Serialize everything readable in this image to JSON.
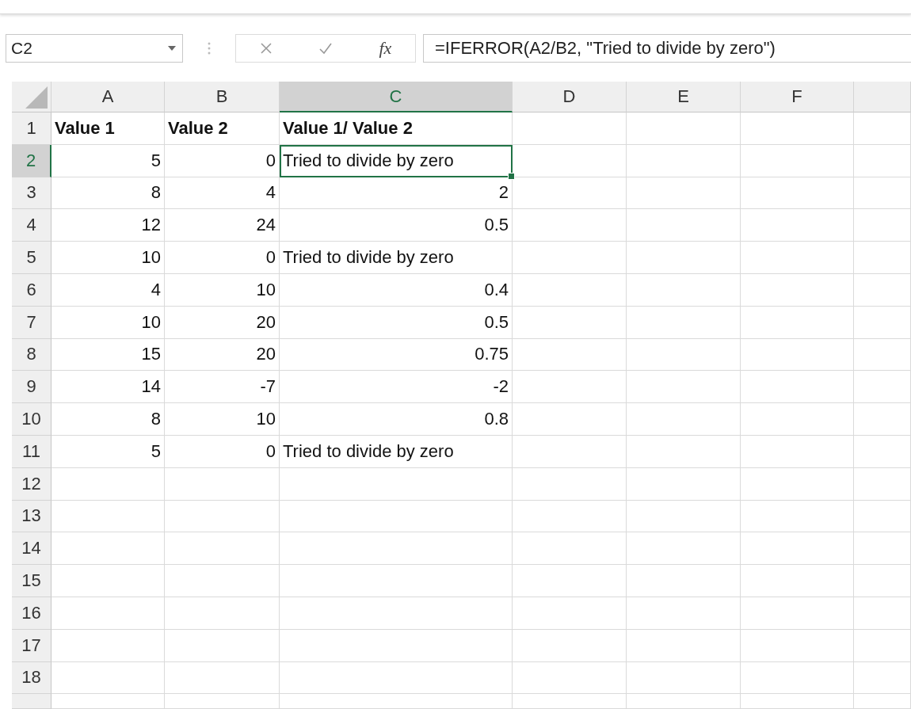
{
  "formula_bar": {
    "name_box": "C2",
    "fx": "fx",
    "formula": "=IFERROR(A2/B2, \"Tried to divide by zero\")"
  },
  "columns": [
    {
      "label": "A",
      "selected": false
    },
    {
      "label": "B",
      "selected": false
    },
    {
      "label": "C",
      "selected": true
    },
    {
      "label": "D",
      "selected": false
    },
    {
      "label": "E",
      "selected": false
    },
    {
      "label": "F",
      "selected": false
    }
  ],
  "rows": [
    {
      "label": "1",
      "selected": false,
      "cells": [
        {
          "text": "Value 1",
          "kind": "header",
          "selected": false
        },
        {
          "text": "Value 2",
          "kind": "header",
          "selected": false
        },
        {
          "text": "Value 1/ Value 2",
          "kind": "header",
          "selected": false
        }
      ]
    },
    {
      "label": "2",
      "selected": true,
      "cells": [
        {
          "text": "5",
          "kind": "number",
          "selected": false
        },
        {
          "text": "0",
          "kind": "number",
          "selected": false
        },
        {
          "text": "Tried to divide by zero",
          "kind": "text",
          "selected": true
        }
      ]
    },
    {
      "label": "3",
      "selected": false,
      "cells": [
        {
          "text": "8",
          "kind": "number",
          "selected": false
        },
        {
          "text": "4",
          "kind": "number",
          "selected": false
        },
        {
          "text": "2",
          "kind": "number",
          "selected": false
        }
      ]
    },
    {
      "label": "4",
      "selected": false,
      "cells": [
        {
          "text": "12",
          "kind": "number",
          "selected": false
        },
        {
          "text": "24",
          "kind": "number",
          "selected": false
        },
        {
          "text": "0.5",
          "kind": "number",
          "selected": false
        }
      ]
    },
    {
      "label": "5",
      "selected": false,
      "cells": [
        {
          "text": "10",
          "kind": "number",
          "selected": false
        },
        {
          "text": "0",
          "kind": "number",
          "selected": false
        },
        {
          "text": "Tried to divide by zero",
          "kind": "text",
          "selected": false
        }
      ]
    },
    {
      "label": "6",
      "selected": false,
      "cells": [
        {
          "text": "4",
          "kind": "number",
          "selected": false
        },
        {
          "text": "10",
          "kind": "number",
          "selected": false
        },
        {
          "text": "0.4",
          "kind": "number",
          "selected": false
        }
      ]
    },
    {
      "label": "7",
      "selected": false,
      "cells": [
        {
          "text": "10",
          "kind": "number",
          "selected": false
        },
        {
          "text": "20",
          "kind": "number",
          "selected": false
        },
        {
          "text": "0.5",
          "kind": "number",
          "selected": false
        }
      ]
    },
    {
      "label": "8",
      "selected": false,
      "cells": [
        {
          "text": "15",
          "kind": "number",
          "selected": false
        },
        {
          "text": "20",
          "kind": "number",
          "selected": false
        },
        {
          "text": "0.75",
          "kind": "number",
          "selected": false
        }
      ]
    },
    {
      "label": "9",
      "selected": false,
      "cells": [
        {
          "text": "14",
          "kind": "number",
          "selected": false
        },
        {
          "text": "-7",
          "kind": "number",
          "selected": false
        },
        {
          "text": "-2",
          "kind": "number",
          "selected": false
        }
      ]
    },
    {
      "label": "10",
      "selected": false,
      "cells": [
        {
          "text": "8",
          "kind": "number",
          "selected": false
        },
        {
          "text": "10",
          "kind": "number",
          "selected": false
        },
        {
          "text": "0.8",
          "kind": "number",
          "selected": false
        }
      ]
    },
    {
      "label": "11",
      "selected": false,
      "cells": [
        {
          "text": "5",
          "kind": "number",
          "selected": false
        },
        {
          "text": "0",
          "kind": "number",
          "selected": false
        },
        {
          "text": "Tried to divide by zero",
          "kind": "text",
          "selected": false
        }
      ]
    },
    {
      "label": "12",
      "selected": false
    },
    {
      "label": "13",
      "selected": false
    },
    {
      "label": "14",
      "selected": false
    },
    {
      "label": "15",
      "selected": false
    },
    {
      "label": "16",
      "selected": false
    },
    {
      "label": "17",
      "selected": false
    },
    {
      "label": "18",
      "selected": false
    }
  ]
}
